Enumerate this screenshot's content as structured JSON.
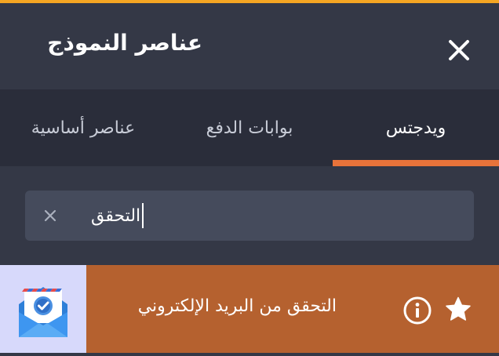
{
  "header": {
    "title": "عناصر النموذج",
    "close_icon": "close-icon"
  },
  "tabs": [
    {
      "label": "ويدجتس",
      "active": true
    },
    {
      "label": "بوابات الدفع",
      "active": false
    },
    {
      "label": "عناصر أساسية",
      "active": false
    }
  ],
  "search": {
    "value": "التحقق",
    "clear_icon": "clear-icon"
  },
  "results": [
    {
      "label": "التحقق من البريد الإلكتروني",
      "thumbnail_icon": "email-verification-icon",
      "info_icon": "info-icon",
      "favorite_icon": "star-icon"
    }
  ],
  "colors": {
    "accent_top": "#F5A623",
    "tab_indicator": "#E8733A",
    "result_background": "#B5612F",
    "header_background": "#343846",
    "tabs_background": "#2A2D3A"
  }
}
